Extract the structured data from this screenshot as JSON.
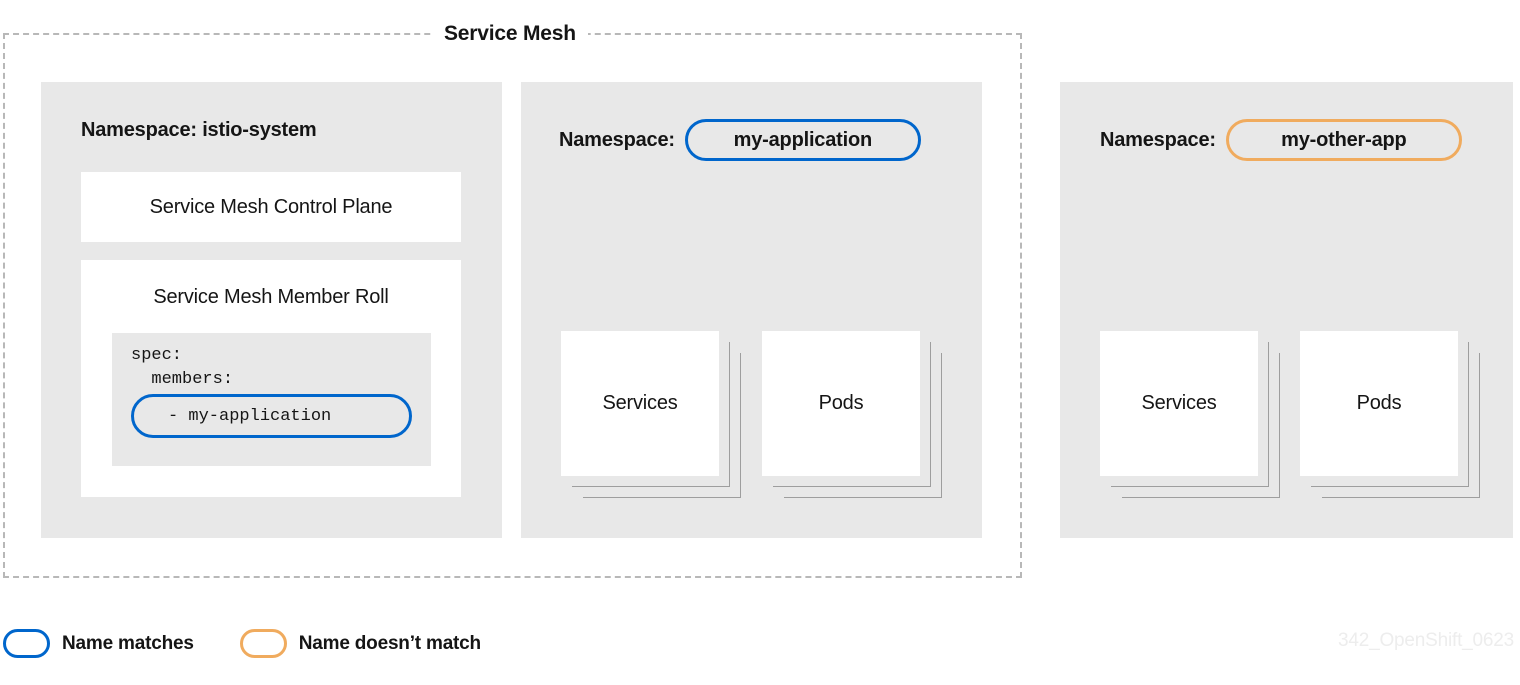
{
  "mesh": {
    "title": "Service Mesh"
  },
  "namespaces": [
    {
      "label": "Namespace: istio-system",
      "prefix": "Namespace:",
      "name": "istio-system",
      "pill": "none"
    },
    {
      "prefix": "Namespace:",
      "name": "my-application",
      "pill": "blue"
    },
    {
      "prefix": "Namespace:",
      "name": "my-other-app",
      "pill": "orange"
    }
  ],
  "istio_system": {
    "control_plane": {
      "title": "Service Mesh Control Plane"
    },
    "member_roll": {
      "title": "Service Mesh Member Roll",
      "code": {
        "line1": "spec:",
        "line2": "  members:",
        "highlighted_line": "- my-application"
      }
    }
  },
  "my_application": {
    "resources": [
      {
        "label": "Services"
      },
      {
        "label": "Pods"
      }
    ]
  },
  "my_other_app": {
    "resources": [
      {
        "label": "Services"
      },
      {
        "label": "Pods"
      }
    ]
  },
  "legend": {
    "items": [
      {
        "label": "Name matches",
        "color": "#0066cc"
      },
      {
        "label": "Name doesn’t match",
        "color": "#f0ab5e"
      }
    ]
  },
  "watermark": {
    "text": "342_OpenShift_0623"
  },
  "colors": {
    "blue": "#0066cc",
    "orange": "#f0ab5e",
    "panel_gray": "#e8e8e8",
    "dashed_border": "#b8b8b8",
    "card_edge": "#9e9e9e",
    "text": "#151515",
    "watermark": "#ededed"
  }
}
